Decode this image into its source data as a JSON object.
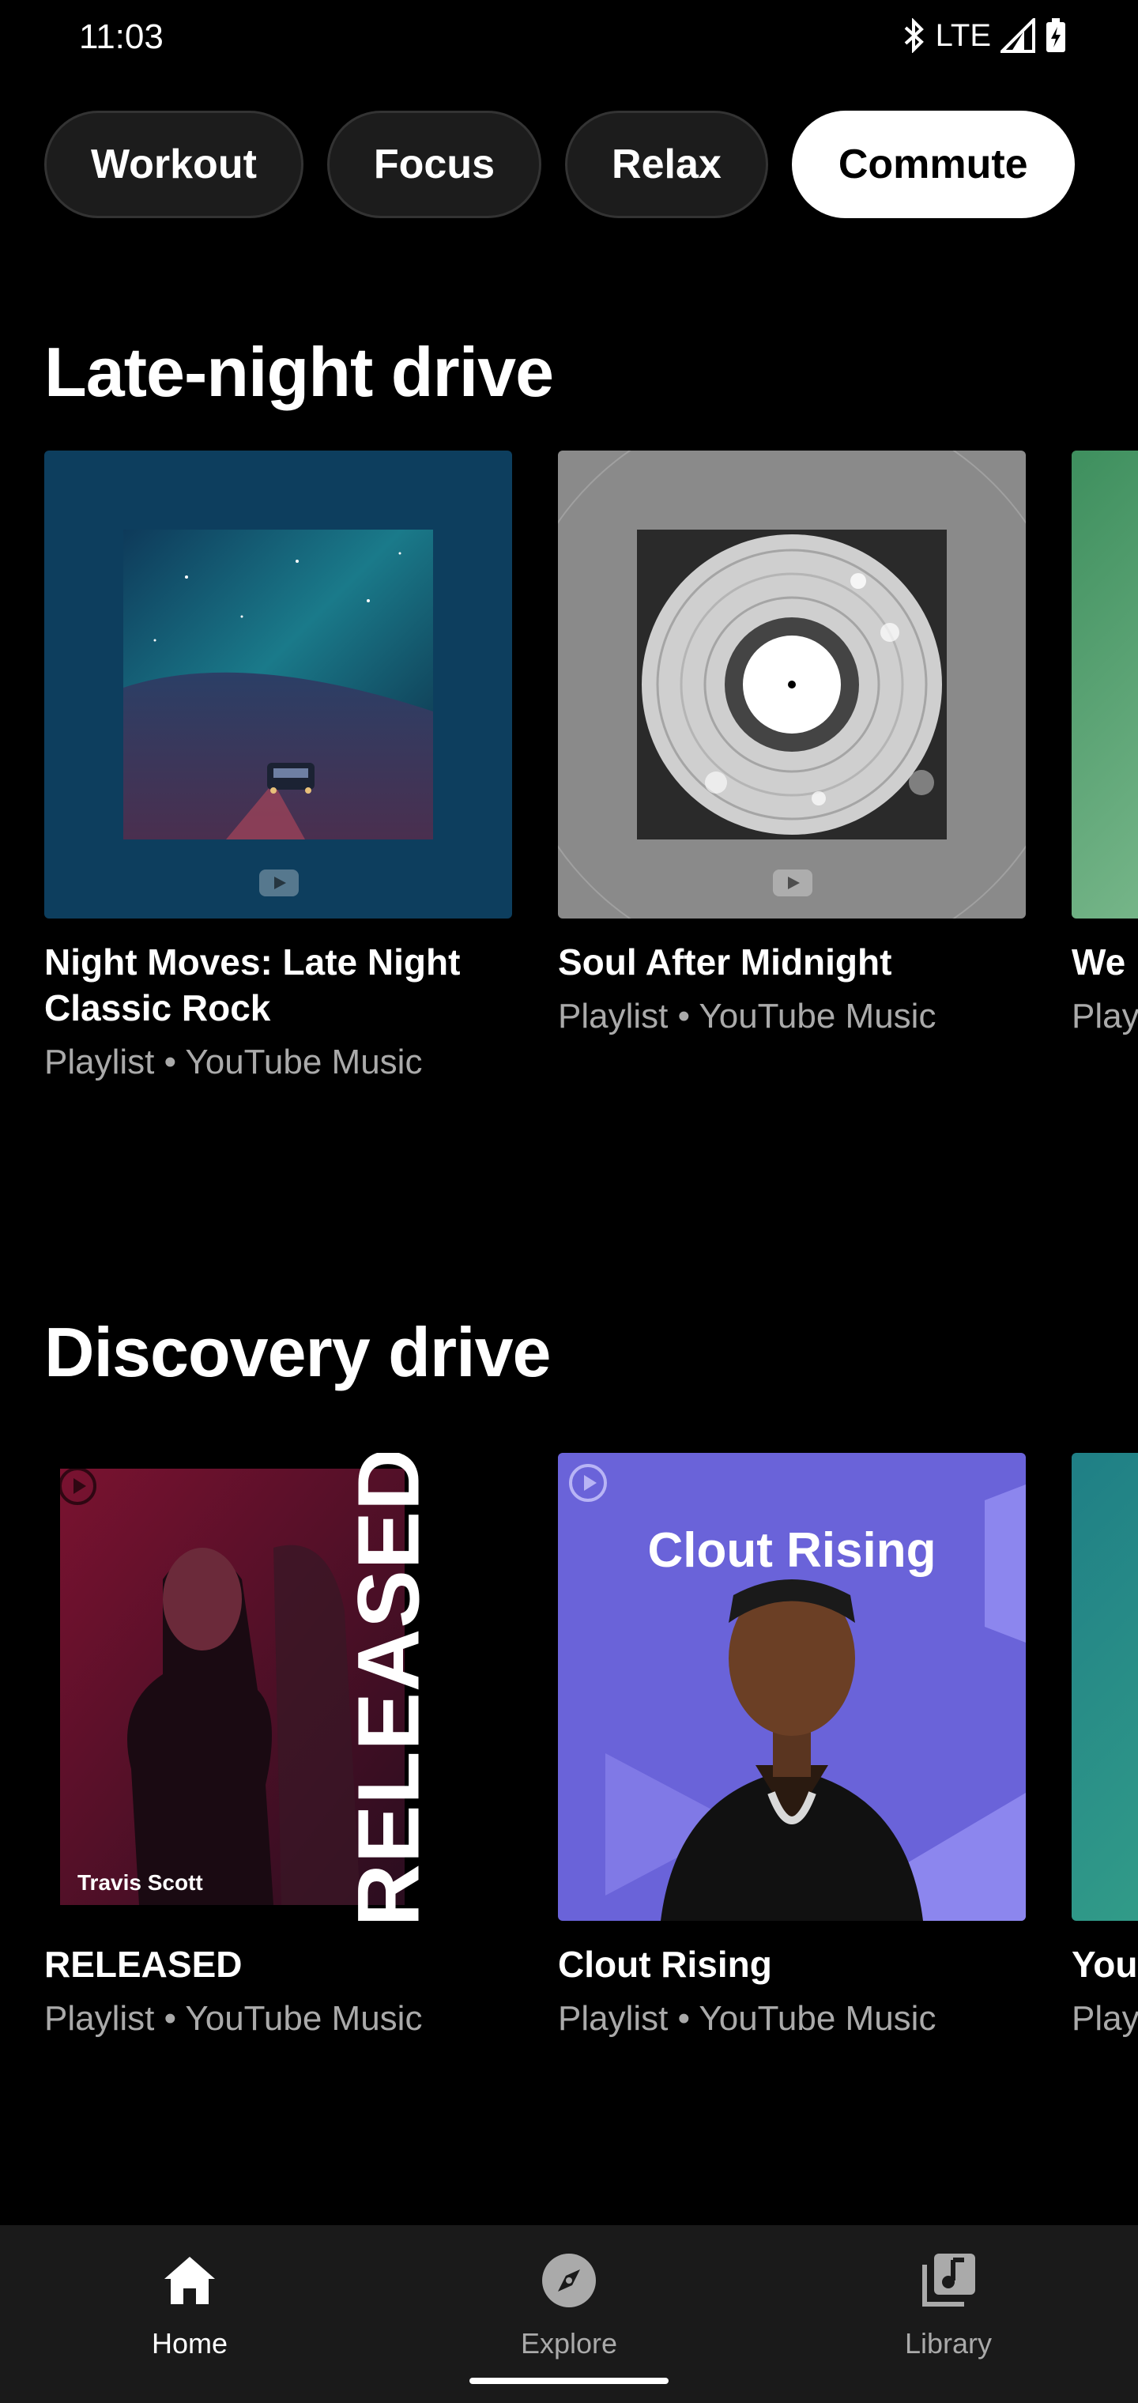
{
  "status_bar": {
    "time": "11:03",
    "network": "LTE"
  },
  "chips": [
    {
      "label": "Workout",
      "selected": false
    },
    {
      "label": "Focus",
      "selected": false
    },
    {
      "label": "Relax",
      "selected": false
    },
    {
      "label": "Commute",
      "selected": true
    }
  ],
  "sections": [
    {
      "title": "Late-night drive",
      "cards": [
        {
          "title": "Night Moves: Late Night Classic Rock",
          "subtitle": "Playlist • YouTube Music"
        },
        {
          "title": "Soul After Midnight",
          "subtitle": "Playlist • YouTube Music"
        },
        {
          "title": "We I",
          "subtitle": "Play"
        }
      ]
    },
    {
      "title": "Discovery drive",
      "cards": [
        {
          "title": "RELEASED",
          "subtitle": "Playlist • YouTube Music",
          "cover_text": "RELEASED",
          "cover_artist": "Travis Scott"
        },
        {
          "title": "Clout Rising",
          "subtitle": "Playlist • YouTube Music",
          "cover_text": "Clout Rising"
        },
        {
          "title": "You",
          "subtitle": "Play"
        }
      ]
    }
  ],
  "bottom_nav": [
    {
      "label": "Home",
      "icon": "home-icon",
      "active": true
    },
    {
      "label": "Explore",
      "icon": "explore-icon",
      "active": false
    },
    {
      "label": "Library",
      "icon": "library-icon",
      "active": false
    }
  ],
  "colors": {
    "background": "#000000",
    "chip_selected": "#ffffff",
    "chip_bg": "#1c1c1c",
    "subtitle": "#aaaaaa",
    "nav_bg": "#1a1a1a"
  }
}
